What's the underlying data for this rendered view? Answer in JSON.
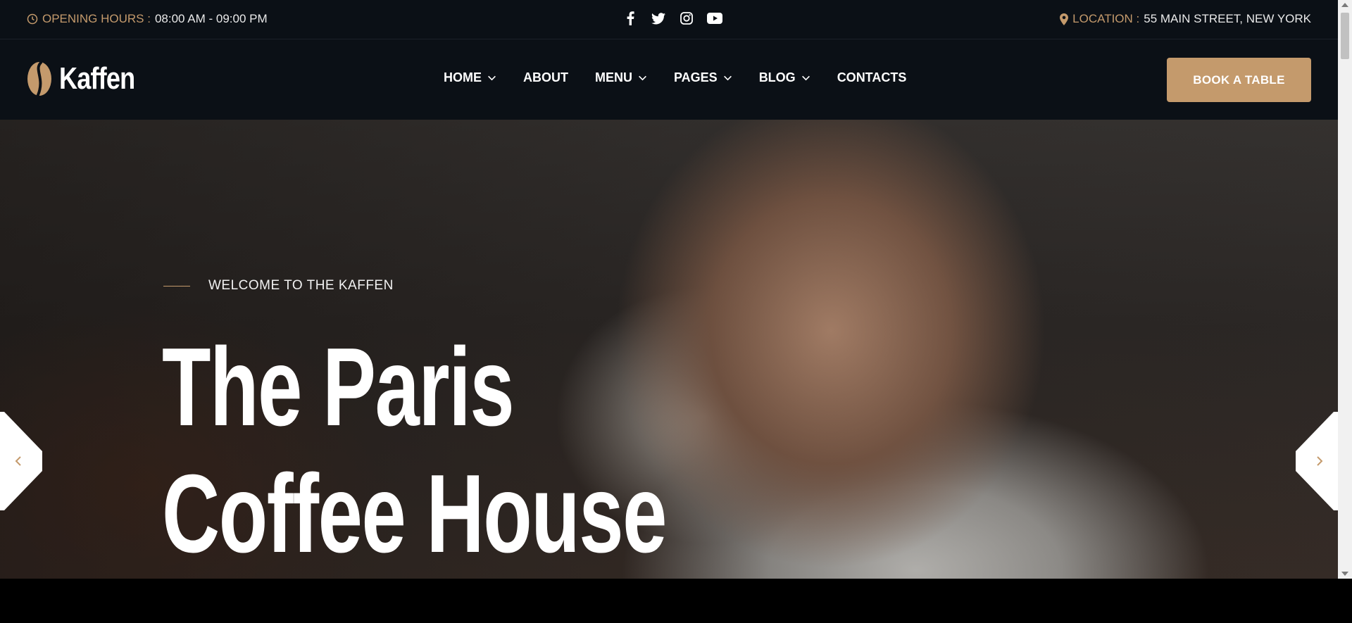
{
  "topbar": {
    "hours_label": "OPENING HOURS :",
    "hours_value": "08:00 AM - 09:00 PM",
    "location_label": "LOCATION :",
    "location_value": "55 MAIN STREET, NEW YORK",
    "social_icons": [
      "facebook-icon",
      "twitter-icon",
      "instagram-icon",
      "youtube-icon"
    ]
  },
  "brand": {
    "name": "Kaffen"
  },
  "nav": {
    "items": [
      {
        "label": "HOME",
        "dropdown": true
      },
      {
        "label": "ABOUT",
        "dropdown": false
      },
      {
        "label": "MENU",
        "dropdown": true
      },
      {
        "label": "PAGES",
        "dropdown": true
      },
      {
        "label": "BLOG",
        "dropdown": true
      },
      {
        "label": "CONTACTS",
        "dropdown": false
      }
    ],
    "cta": "BOOK A TABLE"
  },
  "hero": {
    "eyebrow": "WELCOME TO THE KAFFEN",
    "title_line1": "The Paris",
    "title_line2": "Coffee House"
  },
  "colors": {
    "accent": "#c49a6c",
    "background": "#0b1016"
  }
}
